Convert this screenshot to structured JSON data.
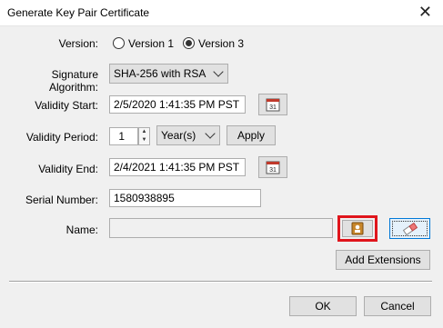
{
  "window": {
    "title": "Generate Key Pair Certificate",
    "close_icon": "close-icon"
  },
  "version": {
    "label": "Version:",
    "options": [
      {
        "label": "Version 1",
        "selected": false
      },
      {
        "label": "Version 3",
        "selected": true
      }
    ]
  },
  "signature": {
    "label": "Signature Algorithm:",
    "value": "SHA-256 with RSA"
  },
  "validity_start": {
    "label": "Validity Start:",
    "value": "2/5/2020 1:41:35 PM PST",
    "icon": "calendar-icon"
  },
  "validity_period": {
    "label": "Validity Period:",
    "value": "1",
    "unit": "Year(s)",
    "apply_label": "Apply"
  },
  "validity_end": {
    "label": "Validity End:",
    "value": "2/4/2021 1:41:35 PM PST",
    "icon": "calendar-icon"
  },
  "serial": {
    "label": "Serial Number:",
    "value": "1580938895"
  },
  "name": {
    "label": "Name:",
    "value": "",
    "address_book_icon": "address-book-icon",
    "eraser_icon": "eraser-icon"
  },
  "add_extensions_label": "Add Extensions",
  "ok_label": "OK",
  "cancel_label": "Cancel",
  "colors": {
    "highlight": "#e0151c",
    "focus": "#0078d7",
    "background": "#f0f0f0"
  }
}
